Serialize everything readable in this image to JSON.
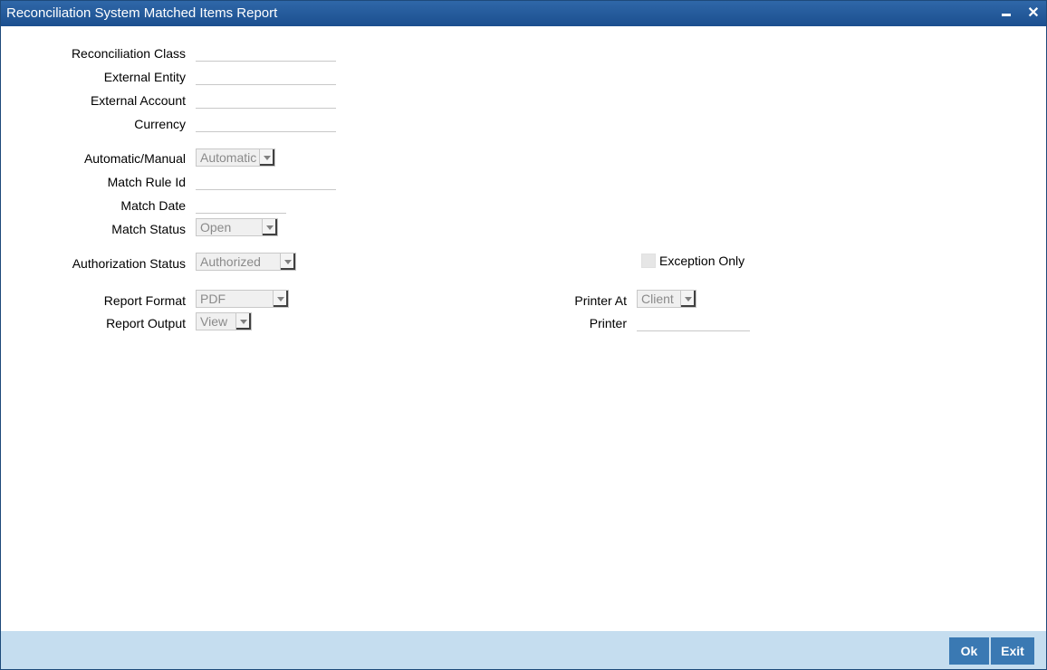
{
  "window": {
    "title": "Reconciliation System Matched Items Report"
  },
  "form": {
    "reconciliation_class": {
      "label": "Reconciliation Class",
      "value": ""
    },
    "external_entity": {
      "label": "External Entity",
      "value": ""
    },
    "external_account": {
      "label": "External Account",
      "value": ""
    },
    "currency": {
      "label": "Currency",
      "value": ""
    },
    "automatic_manual": {
      "label": "Automatic/Manual",
      "selected": "Automatic"
    },
    "match_rule_id": {
      "label": "Match Rule Id",
      "value": ""
    },
    "match_date": {
      "label": "Match Date",
      "value": ""
    },
    "match_status": {
      "label": "Match Status",
      "selected": "Open"
    },
    "authorization_status": {
      "label": "Authorization Status",
      "selected": "Authorized"
    },
    "exception_only": {
      "label": "Exception Only",
      "checked": false
    },
    "report_format": {
      "label": "Report Format",
      "selected": "PDF"
    },
    "report_output": {
      "label": "Report Output",
      "selected": "View"
    },
    "printer_at": {
      "label": "Printer At",
      "selected": "Client"
    },
    "printer": {
      "label": "Printer",
      "value": ""
    }
  },
  "footer": {
    "ok_label": "Ok",
    "exit_label": "Exit"
  },
  "colors": {
    "titlebar": "#1b4f8f",
    "footer": "#c5ddef",
    "button": "#3a79b3"
  }
}
